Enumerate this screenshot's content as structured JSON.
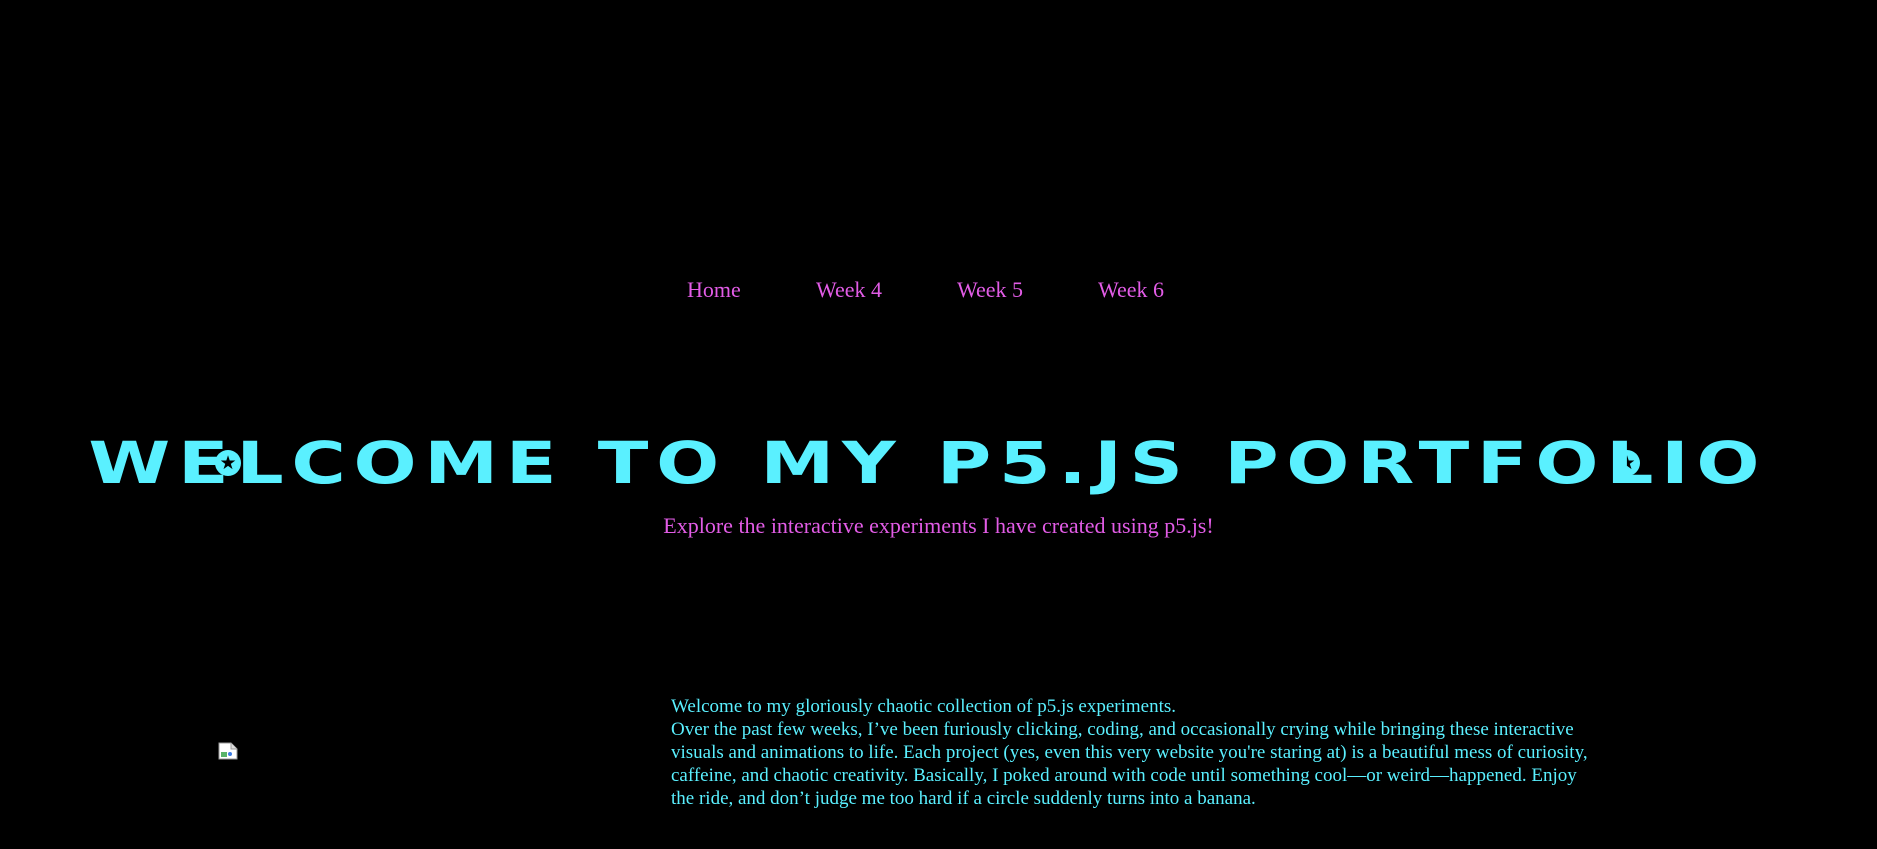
{
  "nav": {
    "items": [
      {
        "label": "Home"
      },
      {
        "label": "Week 4"
      },
      {
        "label": "Week 5"
      },
      {
        "label": "Week 6"
      }
    ],
    "color": "#e25ce6"
  },
  "hero": {
    "title": "Welcome to my p5.js Portfolio",
    "subtitle": "Explore the interactive experiments I have created using p5.js!",
    "title_color": "#5af0ff",
    "decoration_icon": "star-badge-icon"
  },
  "intro": {
    "lead": "Welcome to my gloriously chaotic collection of p5.js experiments.",
    "body": "Over the past few weeks, I’ve been furiously clicking, coding, and occasionally crying while bringing these interactive visuals and animations to life. Each project (yes, even this very website you're staring at) is a beautiful mess of curiosity, caffeine, and chaotic creativity. Basically, I poked around with code until something cool—or weird—happened. Enjoy the ride, and don’t judge me too hard if a circle suddenly turns into a banana.",
    "text_color": "#5af0ff"
  },
  "image": {
    "icon": "broken-image-icon"
  },
  "colors": {
    "background": "#000000",
    "accent_cyan": "#5af0ff",
    "accent_magenta": "#e25ce6"
  }
}
